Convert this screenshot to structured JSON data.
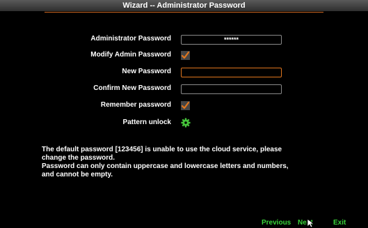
{
  "window": {
    "title": "Wizard -- Administrator Password"
  },
  "form": {
    "admin_password_label": "Administrator Password",
    "admin_password_value": "******",
    "modify_admin_label": "Modify Admin Password",
    "modify_admin_checked": true,
    "new_password_label": "New Password",
    "new_password_value": "",
    "confirm_password_label": "Confirm New Password",
    "confirm_password_value": "",
    "remember_label": "Remember password",
    "remember_checked": true,
    "pattern_label": "Pattern unlock",
    "pattern_icon": "gear-icon"
  },
  "notice": {
    "lines": [
      "The default password [123456] is unable to use the cloud service, please",
      "change the password.",
      "Password can only contain uppercase and lowercase letters and numbers,",
      "and cannot be empty."
    ]
  },
  "footer": {
    "previous_label": "Previous",
    "next_label": "Next",
    "exit_label": "Exit"
  },
  "colors": {
    "accent_orange": "#e0761e",
    "nav_green": "#39d33a",
    "gear_green": "#45c23a"
  }
}
